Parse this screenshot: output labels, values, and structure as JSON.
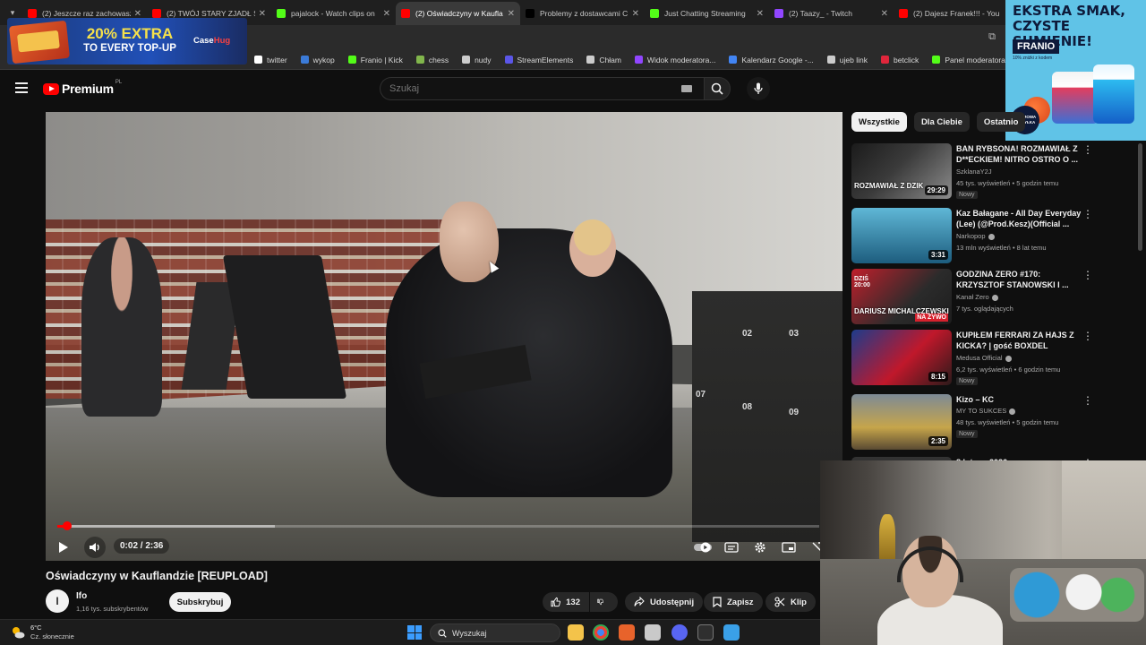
{
  "browser": {
    "tabs": [
      {
        "label": "(2) Jeszcze raz zachowasz",
        "favicon_color": "#ff0000",
        "active": false
      },
      {
        "label": "(2) TWÓJ STARY ZJADŁ ŚL",
        "favicon_color": "#ff0000",
        "active": false
      },
      {
        "label": "pajalock - Watch clips on",
        "favicon_color": "#53fc18",
        "active": false
      },
      {
        "label": "(2) Oświadczyny w Kaufla",
        "favicon_color": "#ff0000",
        "active": true
      },
      {
        "label": "Problemy z dostawcami C",
        "favicon_color": "#000000",
        "active": false
      },
      {
        "label": "Just Chatting Streaming",
        "favicon_color": "#53fc18",
        "active": false
      },
      {
        "label": "(2) Taazy_ - Twitch",
        "favicon_color": "#9146ff",
        "active": false
      },
      {
        "label": "(2) Dajesz Franek!!! - You",
        "favicon_color": "#ff0000",
        "active": false
      }
    ],
    "bookmarks": [
      {
        "label": "twitter",
        "icon": "x-icon",
        "color": "#ffffff"
      },
      {
        "label": "wykop",
        "icon": "wykop-icon",
        "color": "#3b7bd8"
      },
      {
        "label": "Franio | Kick",
        "icon": "kick-icon",
        "color": "#53fc18"
      },
      {
        "label": "chess",
        "icon": "pawn-icon",
        "color": "#81b64c"
      },
      {
        "label": "nudy",
        "icon": "folder-icon",
        "color": "#cccccc"
      },
      {
        "label": "StreamElements",
        "icon": "streamelements-icon",
        "color": "#5b56e8"
      },
      {
        "label": "Chłam",
        "icon": "globe-icon",
        "color": "#cccccc"
      },
      {
        "label": "Widok moderatora...",
        "icon": "twitch-icon",
        "color": "#9146ff"
      },
      {
        "label": "Kalendarz Google -...",
        "icon": "calendar-icon",
        "color": "#4285f4"
      },
      {
        "label": "ujeb link",
        "icon": "globe-icon",
        "color": "#cccccc"
      },
      {
        "label": "betclick",
        "icon": "betclic-icon",
        "color": "#e0263b"
      },
      {
        "label": "Panel moderatora |...",
        "icon": "kick-icon",
        "color": "#53fc18"
      }
    ]
  },
  "ads": {
    "left": {
      "line1": "20% EXTRA",
      "line2": "TO EVERY TOP-UP",
      "brand_a": "Case",
      "brand_b": "Hug"
    },
    "right": {
      "headline": "EKSTRA SMAK, CZYSTE SUMIENIE!",
      "brand": "FRANIO",
      "small": "10% zniżki z kodem",
      "badge": "DARMOWA WYSYŁKA"
    }
  },
  "youtube": {
    "logo": "Premium",
    "region": "PL",
    "search_placeholder": "Szukaj",
    "video": {
      "title": "Oświadczyny w Kauflandzie [REUPLOAD]",
      "time": "0:02 / 2:36",
      "progress": 0.013,
      "buffered": 0.285
    },
    "channel": {
      "name": "Ifo",
      "subs": "1,16 tys. subskrybentów",
      "avatar_letter": "I",
      "subscribe_label": "Subskrybuj"
    },
    "actions": {
      "likes": "132",
      "share": "Udostępnij",
      "save": "Zapisz",
      "clip": "Klip"
    },
    "chips": [
      {
        "label": "Wszystkie",
        "active": true
      },
      {
        "label": "Dla Ciebie",
        "active": false
      },
      {
        "label": "Ostatnio",
        "active": false
      }
    ],
    "recommendations": [
      {
        "title": "BAN RYBSONA! ROZMAWIAŁ Z D**ECKIEM! NITRO OSTRO O ...",
        "channel": "SzklanaY2J",
        "meta": "45 tys. wyświetleń • 5 godzin temu",
        "badge": "Nowy",
        "duration": "29:29",
        "verified": false,
        "thumb_text": "ROZMAWIAŁ Z DZIK"
      },
      {
        "title": "Kaz Bałagane - All Day Everyday (Lee) (@Prod.Kesz)(Official ...",
        "channel": "Narkopop",
        "meta": "13 mln wyświetleń • 8 lat temu",
        "badge": "",
        "duration": "3:31",
        "verified": true,
        "thumb_text": ""
      },
      {
        "title": "GODZINA ZERO #170: KRZYSZTOF STANOWSKI I ...",
        "channel": "Kanał Zero",
        "meta": "7 tys. oglądających",
        "badge": "",
        "duration": "",
        "verified": true,
        "thumb_text": "DARIUSZ MICHALCZEWSKI",
        "thumb_live": "NA ŻYWO",
        "thumb_time": "DZIŚ 20:00"
      },
      {
        "title": "KUPIŁEM FERRARI ZA HAJS Z KICKA? | gość BOXDEL",
        "channel": "Medusa Official",
        "meta": "6,2 tys. wyświetleń • 6 godzin temu",
        "badge": "Nowy",
        "duration": "8:15",
        "verified": true,
        "thumb_text": ""
      },
      {
        "title": "Kizo – KC",
        "channel": "MY TO SUKCES",
        "meta": "48 tys. wyświetleń • 5 godzin temu",
        "badge": "Nowy",
        "duration": "2:35",
        "verified": true,
        "thumb_text": ""
      },
      {
        "title": "8 lutego 2026",
        "channel": "",
        "meta": "",
        "badge": "",
        "duration": "",
        "verified": false,
        "thumb_text": ""
      }
    ]
  },
  "taskbar": {
    "temperature": "6°C",
    "condition": "Cz. słonecznie",
    "search": "Wyszukaj"
  }
}
